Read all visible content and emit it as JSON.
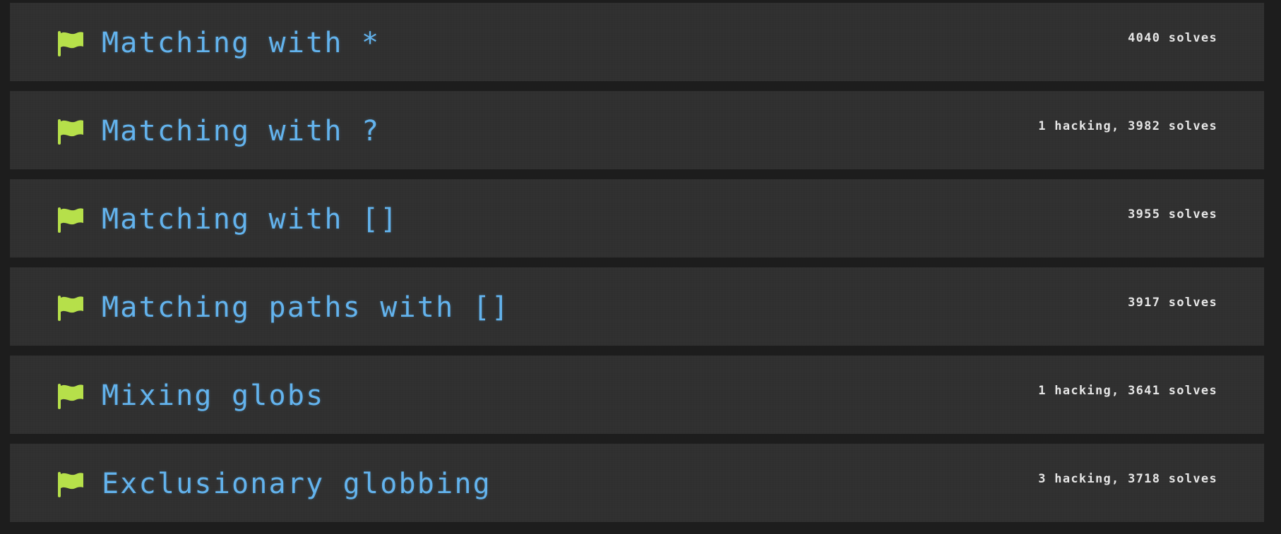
{
  "challenges": [
    {
      "title": "Matching with *",
      "stats": "4040 solves",
      "icon": "flag-icon"
    },
    {
      "title": "Matching with ?",
      "stats": "1 hacking, 3982 solves",
      "icon": "flag-icon"
    },
    {
      "title": "Matching with []",
      "stats": "3955 solves",
      "icon": "flag-icon"
    },
    {
      "title": "Matching paths with []",
      "stats": "3917 solves",
      "icon": "flag-icon"
    },
    {
      "title": "Mixing globs",
      "stats": "1 hacking, 3641 solves",
      "icon": "flag-icon"
    },
    {
      "title": "Exclusionary globbing",
      "stats": "3 hacking, 3718 solves",
      "icon": "flag-icon"
    }
  ],
  "colors": {
    "background": "#1d1d1d",
    "card": "#303030",
    "title": "#63b3ed",
    "flag": "#b6e04a",
    "stats": "#e6e6e6"
  }
}
